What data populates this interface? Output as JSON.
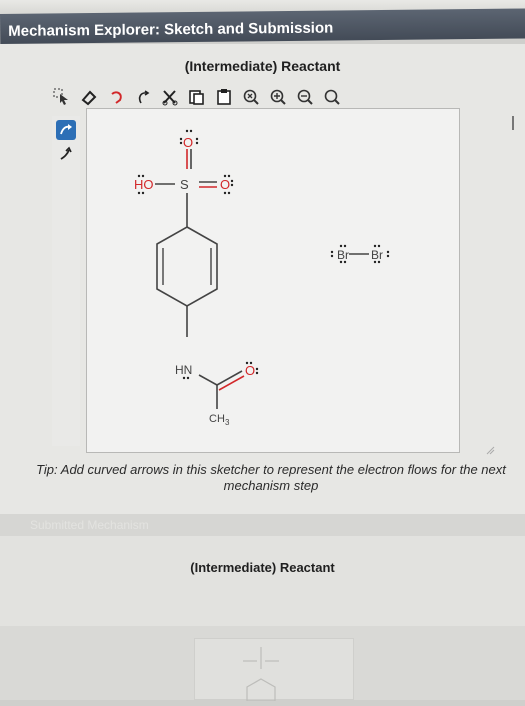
{
  "window": {
    "title": "Mechanism Explorer: Sketch and Submission"
  },
  "top_panel": {
    "heading": "(Intermediate) Reactant"
  },
  "toolbar": {
    "tools": [
      "select-arrow-icon",
      "eraser-icon",
      "undo-icon",
      "redo-icon",
      "cut-icon",
      "copy-icon",
      "paste-icon",
      "zoom-reset-icon",
      "zoom-in-icon",
      "zoom-out-icon",
      "zoom-fit-icon"
    ]
  },
  "sidebar": {
    "tools": [
      "curved-arrow-double-icon",
      "curved-arrow-single-icon"
    ]
  },
  "molecule_1": {
    "atoms": {
      "oxygen_top": "O",
      "hydroxyl": "HO",
      "sulfur": "S",
      "oxygen_right": "O",
      "nitrogen": "HN",
      "carbonyl_oxygen": "O",
      "methyl": "CH",
      "methyl_subscript": "3"
    }
  },
  "molecule_2": {
    "bromine_left": "Br",
    "bromine_right": "Br"
  },
  "tip": {
    "text": "Tip: Add curved arrows in this sketcher to represent the electron flows for the next mechanism step"
  },
  "section_faint": {
    "label": "Submitted Mechanism"
  },
  "bottom_panel": {
    "heading": "(Intermediate) Reactant"
  },
  "colors": {
    "title_bar": "#4b5360",
    "oxygen_red": "#d2282a",
    "accent_blue": "#2d6fb6",
    "bond_gray": "#444444",
    "lone_pair": "#222222"
  }
}
